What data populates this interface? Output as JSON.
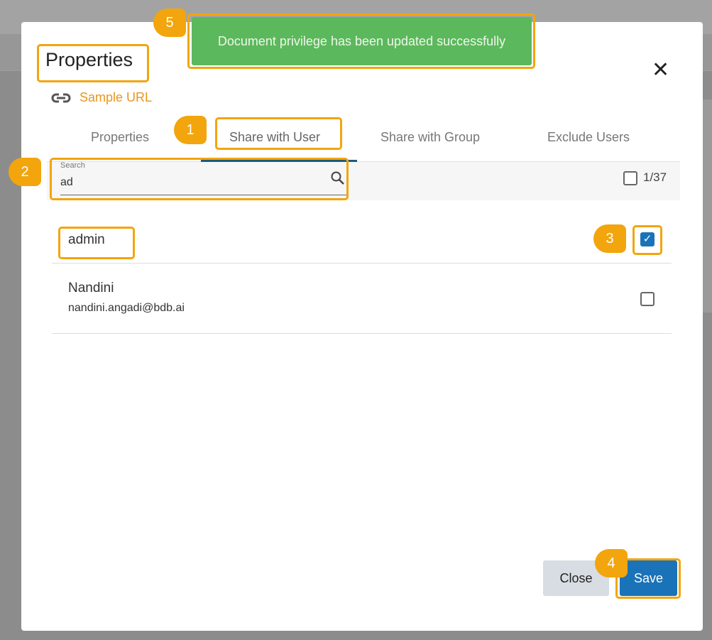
{
  "modal": {
    "title": "Properties",
    "link_label": "Sample URL"
  },
  "tabs": [
    {
      "label": "Properties"
    },
    {
      "label": "Share with User"
    },
    {
      "label": "Share with Group"
    },
    {
      "label": "Exclude Users"
    }
  ],
  "search": {
    "label": "Search",
    "value": "ad"
  },
  "selection_count": "1/37",
  "users": [
    {
      "name": "admin",
      "email": "",
      "checked": true
    },
    {
      "name": "Nandini",
      "email": "nandini.angadi@bdb.ai",
      "checked": false
    }
  ],
  "buttons": {
    "close": "Close",
    "save": "Save"
  },
  "toast": "Document privilege has been updated successfully",
  "callouts": [
    "1",
    "2",
    "3",
    "4",
    "5"
  ],
  "colors": {
    "accent": "#f2a50c",
    "primary": "#1a73b8",
    "success": "#5cb85c",
    "link": "#e8961d"
  }
}
